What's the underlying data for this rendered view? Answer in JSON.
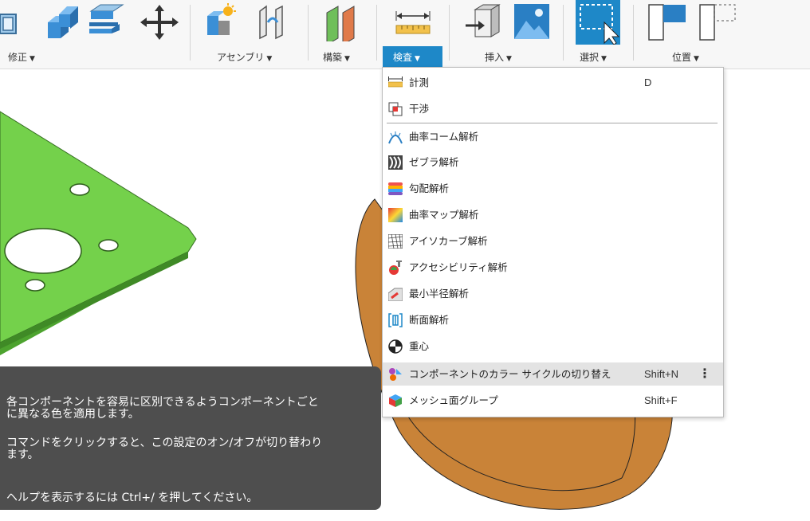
{
  "toolbar": {
    "groups": [
      {
        "label": "修正"
      },
      {
        "label": "アセンブリ"
      },
      {
        "label": "構築"
      },
      {
        "label": "検査"
      },
      {
        "label": "挿入"
      },
      {
        "label": "選択"
      },
      {
        "label": "位置"
      }
    ],
    "active_group": "検査",
    "caret": "▼"
  },
  "inspect_menu": {
    "items": [
      {
        "label": "計測",
        "shortcut": "D",
        "icon": "measure-icon"
      },
      {
        "label": "干渉",
        "shortcut": "",
        "icon": "interference-icon"
      },
      {
        "label": "曲率コーム解析",
        "shortcut": "",
        "icon": "curvature-comb-icon"
      },
      {
        "label": "ゼブラ解析",
        "shortcut": "",
        "icon": "zebra-icon"
      },
      {
        "label": "勾配解析",
        "shortcut": "",
        "icon": "draft-analysis-icon"
      },
      {
        "label": "曲率マップ解析",
        "shortcut": "",
        "icon": "curvature-map-icon"
      },
      {
        "label": "アイソカーブ解析",
        "shortcut": "",
        "icon": "isocurve-icon"
      },
      {
        "label": "アクセシビリティ解析",
        "shortcut": "",
        "icon": "accessibility-icon"
      },
      {
        "label": "最小半径解析",
        "shortcut": "",
        "icon": "min-radius-icon"
      },
      {
        "label": "断面解析",
        "shortcut": "",
        "icon": "section-analysis-icon"
      },
      {
        "label": "重心",
        "shortcut": "",
        "icon": "center-of-mass-icon"
      },
      {
        "label": "コンポーネントのカラー サイクルの切り替え",
        "shortcut": "Shift+N",
        "icon": "component-color-cycle-icon",
        "highlighted": true
      },
      {
        "label": "メッシュ面グループ",
        "shortcut": "Shift+F",
        "icon": "mesh-face-groups-icon"
      }
    ],
    "more_glyph": "⋮"
  },
  "tooltip": {
    "line1": "各コンポーネントを容易に区別できるようコンポーネントごと",
    "line2": "に異なる色を適用します。",
    "line3": "コマンドをクリックすると、この設定のオン/オフが切り替わり",
    "line4": "ます。",
    "line5": "ヘルプを表示するには Ctrl+/ を押してください。"
  },
  "colors": {
    "accent": "#1e88c8",
    "plate_green": "#6fd04a",
    "part_orange": "#cf8c46",
    "tooltip_bg": "#4e4e4e"
  }
}
